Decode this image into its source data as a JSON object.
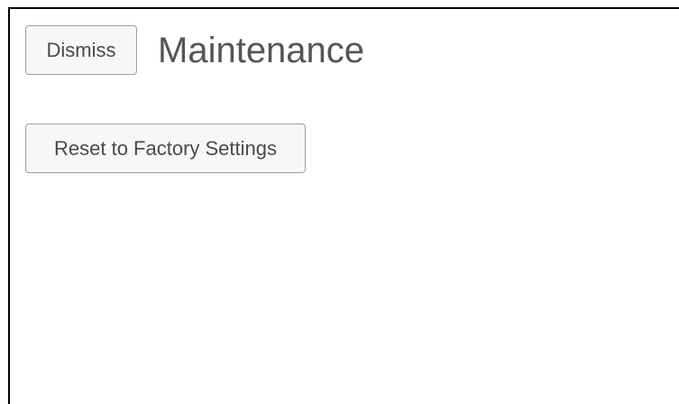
{
  "header": {
    "dismiss_label": "Dismiss",
    "title": "Maintenance"
  },
  "main": {
    "reset_label": "Reset to Factory Settings"
  },
  "colors": {
    "background": "#ffffff",
    "border": "#000000",
    "button_bg": "#f7f7f7",
    "button_border": "#9e9e9e",
    "text": "#555555"
  }
}
